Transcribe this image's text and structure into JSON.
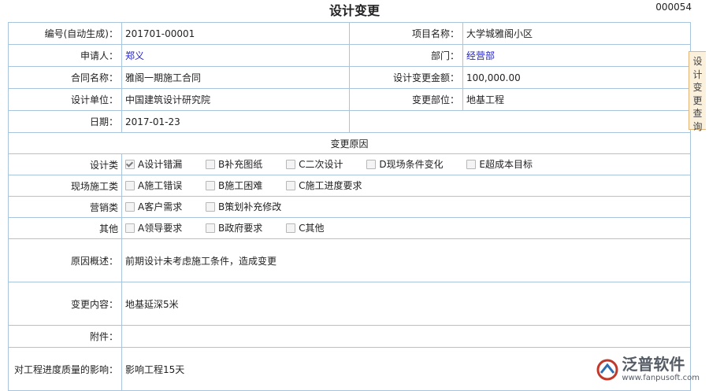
{
  "header": {
    "title": "设计变更",
    "doc_number": "000054"
  },
  "form": {
    "number": {
      "label": "编号(自动生成)：",
      "value": "201701-00001"
    },
    "project": {
      "label": "项目名称：",
      "value": "大学城雅阁小区"
    },
    "applicant": {
      "label": "申请人：",
      "value": "郑义"
    },
    "department": {
      "label": "部门：",
      "value": "经营部"
    },
    "contract": {
      "label": "合同名称：",
      "value": "雅阁一期施工合同"
    },
    "amount": {
      "label": "设计变更金额：",
      "value": "100,000.00"
    },
    "design_unit": {
      "label": "设计单位：",
      "value": "中国建筑设计研究院"
    },
    "change_part": {
      "label": "变更部位：",
      "value": "地基工程"
    },
    "date": {
      "label": "日期：",
      "value": "2017-01-23"
    },
    "reason_header": "变更原因",
    "design_category": {
      "label": "设计类",
      "options": [
        {
          "label": "A设计错漏",
          "checked": true
        },
        {
          "label": "B补充图纸",
          "checked": false
        },
        {
          "label": "C二次设计",
          "checked": false
        },
        {
          "label": "D现场条件变化",
          "checked": false
        },
        {
          "label": "E超成本目标",
          "checked": false
        }
      ]
    },
    "site_category": {
      "label": "现场施工类",
      "options": [
        {
          "label": "A施工错误",
          "checked": false
        },
        {
          "label": "B施工困难",
          "checked": false
        },
        {
          "label": "C施工进度要求",
          "checked": false
        }
      ]
    },
    "marketing_category": {
      "label": "营销类",
      "options": [
        {
          "label": "A客户需求",
          "checked": false
        },
        {
          "label": "B策划补充修改",
          "checked": false
        }
      ]
    },
    "other_category": {
      "label": "其他",
      "options": [
        {
          "label": "A领导要求",
          "checked": false
        },
        {
          "label": "B政府要求",
          "checked": false
        },
        {
          "label": "C其他",
          "checked": false
        }
      ]
    },
    "reason_summary": {
      "label": "原因概述：",
      "value": "前期设计未考虑施工条件，造成变更"
    },
    "change_content": {
      "label": "变更内容：",
      "value": "地基延深5米"
    },
    "attachment": {
      "label": "附件：",
      "value": ""
    },
    "impact": {
      "label": "对工程进度质量的影响：",
      "value": "影响工程15天"
    }
  },
  "side_tab": {
    "chars": [
      "设",
      "计",
      "变",
      "更",
      "查",
      "询"
    ]
  },
  "watermark": {
    "brand": "泛普软件",
    "url": "www.fanpusoft.com"
  },
  "colors": {
    "border": "#a9c4dd",
    "link": "#2222cc",
    "tab_bg": "#fbf0dc",
    "tab_border": "#e2b57a"
  }
}
